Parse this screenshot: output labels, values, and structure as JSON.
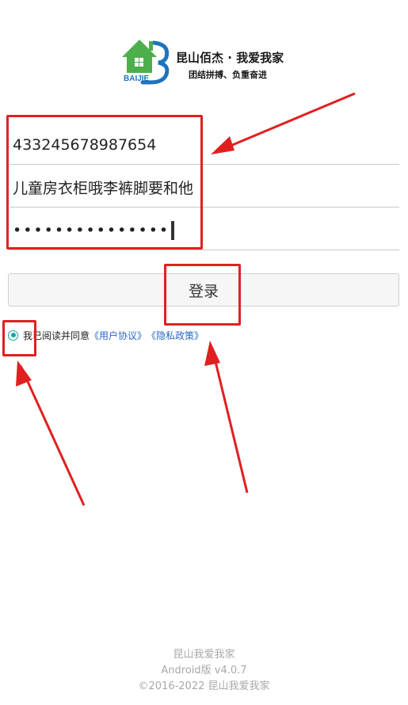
{
  "logo": {
    "icon": "house-logo-icon",
    "brand_text": "BAIJIE",
    "company_name": "昆山佰杰 · 我爱我家",
    "slogan": "团结拼搏、负重奋进",
    "colors": {
      "house": "#4cae4c",
      "swoosh": "#1e73be"
    }
  },
  "form": {
    "account_value": "433245678987654",
    "name_value": "儿童房衣柜哦李裤脚要和他",
    "password_dots": "•••••••••••••••"
  },
  "login": {
    "label": "登录"
  },
  "agreement": {
    "prefix": "我已阅读并同意",
    "user_agreement": "《用户协议》",
    "privacy_policy": "《隐私政策》",
    "checked": true
  },
  "footer": {
    "app_name": "昆山我爱我家",
    "version": "Android版  v4.0.7",
    "copyright": "©2016-2022 昆山我爱我家"
  },
  "annotations": {
    "color": "#e02020"
  }
}
